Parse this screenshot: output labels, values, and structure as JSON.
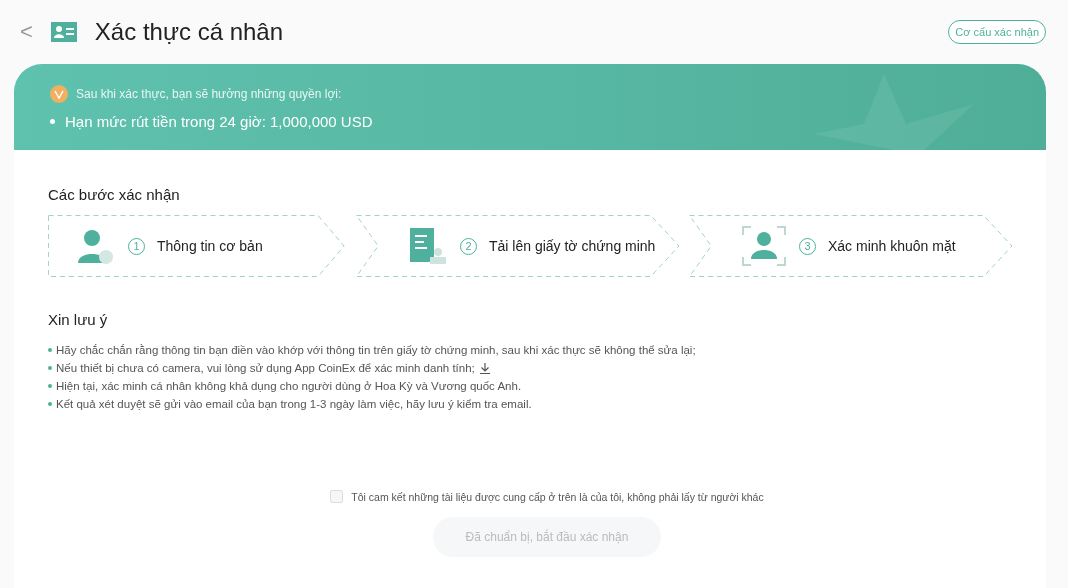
{
  "header": {
    "back": "<",
    "title": "Xác thực cá nhân",
    "link": "Cơ cấu xác nhận"
  },
  "banner": {
    "intro": "Sau khi xác thực, bạn sẽ hưởng những quyền lợi:",
    "benefits": [
      "Hạn mức rút tiền trong 24 giờ: 1,000,000 USD"
    ]
  },
  "steps": {
    "title": "Các bước xác nhận",
    "items": [
      {
        "kind": "person",
        "number": "1",
        "label": "Thông tin cơ bản"
      },
      {
        "kind": "document",
        "number": "2",
        "label": "Tải lên giấy tờ chứng minh"
      },
      {
        "kind": "face",
        "number": "3",
        "label": "Xác minh khuôn mặt"
      }
    ]
  },
  "notes": {
    "title": "Xin lưu ý",
    "items": [
      {
        "text": "Hãy chắc chắn rằng thông tin bạn điền vào khớp với thông tin trên giấy tờ chứng minh, sau khi xác thực sẽ không thể sửa lại;",
        "download": false
      },
      {
        "text": "Nếu thiết bị chưa có camera, vui lòng sử dụng App CoinEx để xác minh danh tính;",
        "download": true
      },
      {
        "text": "Hiện tại, xác minh cá nhân không khả dụng cho người dùng ở Hoa Kỳ và Vương quốc Anh.",
        "download": false
      },
      {
        "text": "Kết quả xét duyệt sẽ gửi vào email của bạn trong 1-3 ngày làm việc, hãy lưu ý kiểm tra email.",
        "download": false
      }
    ]
  },
  "agreement": {
    "label": "Tôi cam kết những tài liệu được cung cấp ở trên là của tôi, không phải lấy từ người khác",
    "checked": false
  },
  "submit": {
    "label": "Đã chuẩn bị, bắt đầu xác nhận",
    "disabled": true
  }
}
